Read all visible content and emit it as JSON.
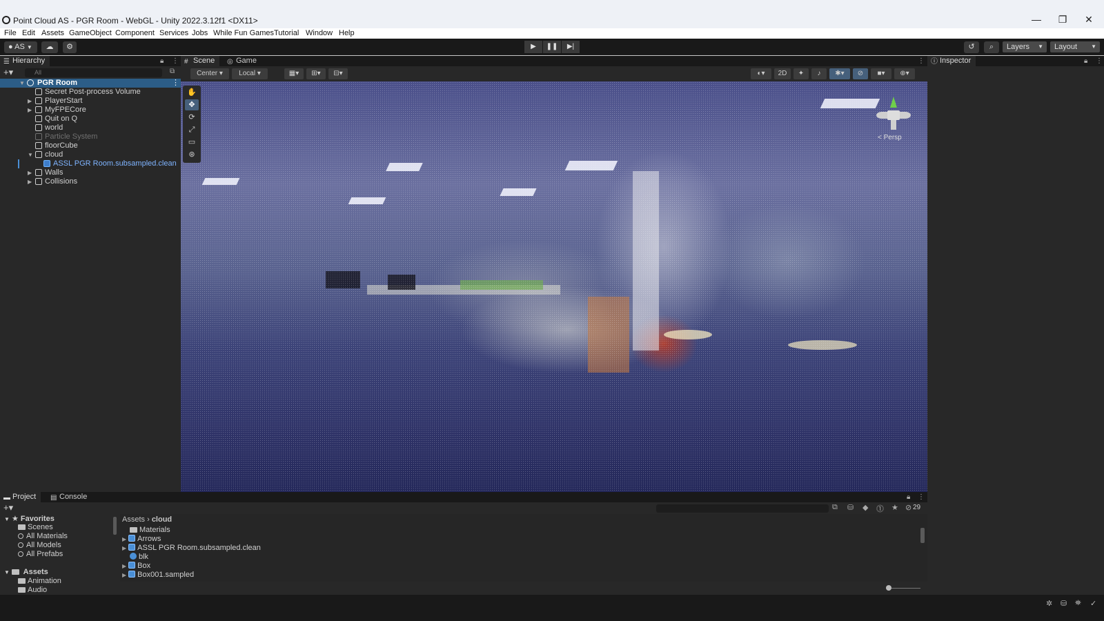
{
  "window": {
    "title": "Point Cloud AS - PGR Room - WebGL - Unity 2022.3.12f1 <DX11>",
    "controls": [
      "—",
      "❐",
      "✕"
    ]
  },
  "menu": [
    "File",
    "Edit",
    "Assets",
    "GameObject",
    "Component",
    "Services",
    "Jobs",
    "While Fun Games",
    "Tutorial",
    "Window",
    "Help"
  ],
  "toolbar": {
    "account_label": "AS",
    "layers_label": "Layers",
    "layout_label": "Layout",
    "play_icons": [
      "▶",
      "❚❚",
      "▶|"
    ]
  },
  "hierarchy": {
    "tab_label": "Hierarchy",
    "search_placeholder": "All",
    "items": [
      {
        "label": "PGR Room",
        "depth": 0,
        "expanded": true,
        "selected": true
      },
      {
        "label": "Secret Post-process Volume",
        "depth": 1
      },
      {
        "label": "PlayerStart",
        "depth": 1,
        "collapsed": true
      },
      {
        "label": "MyFPECore",
        "depth": 1,
        "collapsed": true
      },
      {
        "label": "Quit on Q",
        "depth": 1
      },
      {
        "label": "world",
        "depth": 1
      },
      {
        "label": "Particle System",
        "depth": 1,
        "disabled": true
      },
      {
        "label": "floorCube",
        "depth": 1
      },
      {
        "label": "cloud",
        "depth": 1,
        "expanded": true
      },
      {
        "label": "ASSL PGR Room.subsampled.clean",
        "depth": 2,
        "prefab": true
      },
      {
        "label": "Walls",
        "depth": 1,
        "collapsed": true
      },
      {
        "label": "Collisions",
        "depth": 1,
        "collapsed": true
      }
    ]
  },
  "scene": {
    "tabs": [
      "Scene",
      "Game"
    ],
    "pivot_label": "Center",
    "space_label": "Local",
    "mode_2d_label": "2D",
    "persp_label": "< Persp"
  },
  "inspector": {
    "tab_label": "Inspector"
  },
  "project": {
    "tabs": [
      "Project",
      "Console"
    ],
    "hidden_count": "29",
    "favorites_label": "Favorites",
    "favorites": [
      "Scenes",
      "All Materials",
      "All Models",
      "All Prefabs"
    ],
    "assets_label": "Assets",
    "assets_children": [
      "Animation",
      "Audio"
    ],
    "breadcrumb": [
      "Assets",
      "cloud"
    ],
    "files": [
      {
        "label": "Materials",
        "kind": "folder"
      },
      {
        "label": "Arrows",
        "kind": "prefab"
      },
      {
        "label": "ASSL PGR Room.subsampled.clean",
        "kind": "prefab"
      },
      {
        "label": "blk",
        "kind": "material"
      },
      {
        "label": "Box",
        "kind": "prefab"
      },
      {
        "label": "Box001.sampled",
        "kind": "prefab"
      }
    ]
  },
  "colors": {
    "selection": "#2c5d87",
    "panel_bg": "#282828",
    "toolbar_bg": "#191919",
    "prefab_text": "#7fb4ff"
  }
}
